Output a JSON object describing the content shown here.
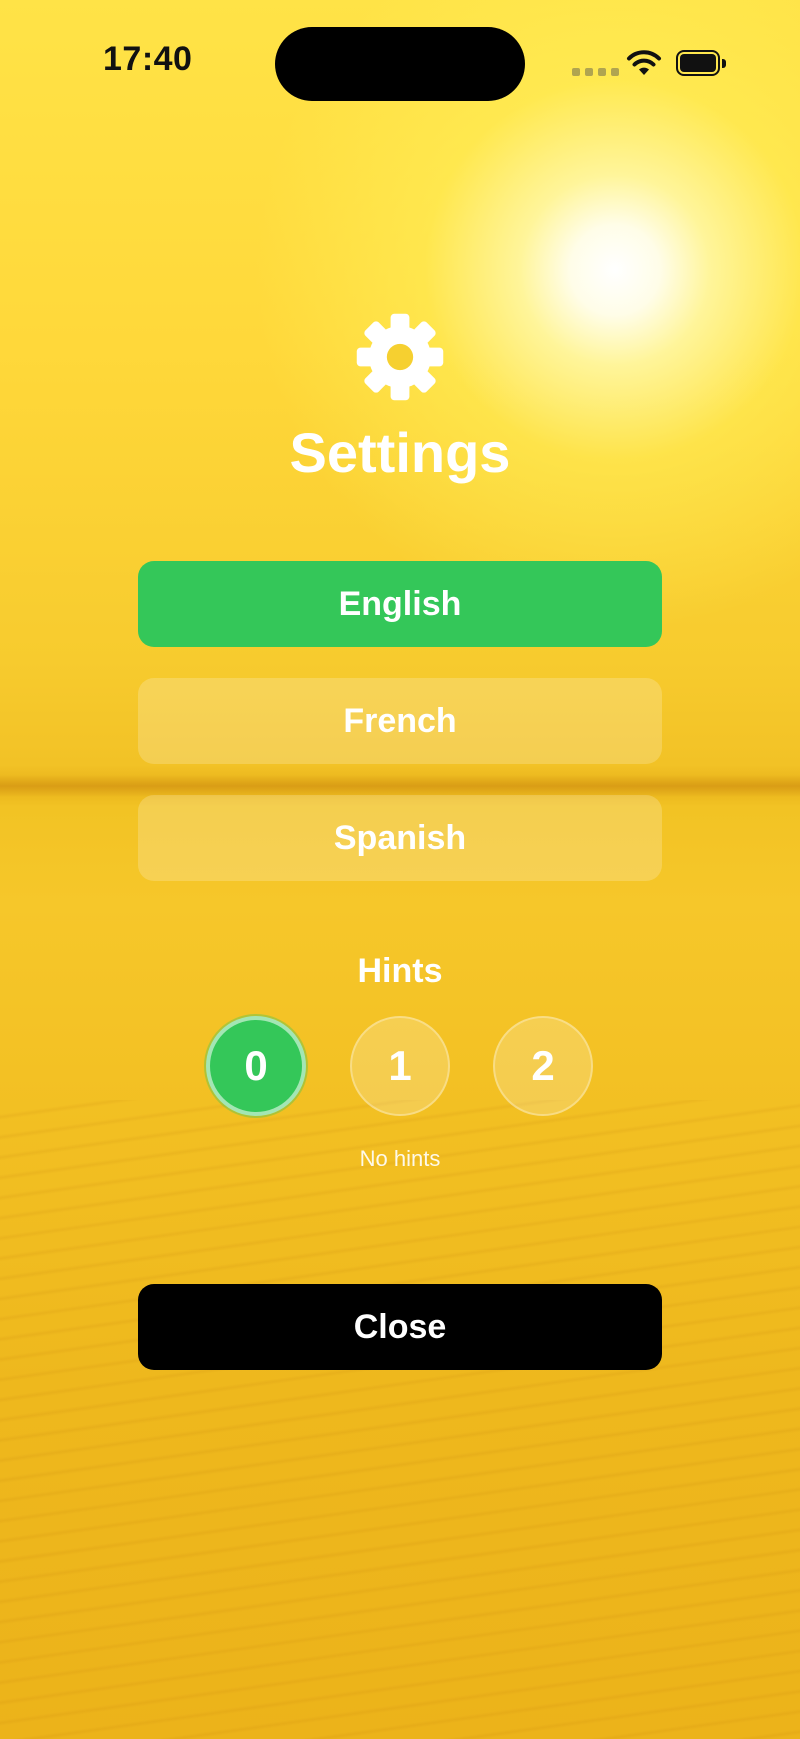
{
  "status_bar": {
    "time": "17:40",
    "icons": [
      "cellular-signal-icon",
      "wifi-icon",
      "battery-icon"
    ]
  },
  "header": {
    "icon": "gear-icon",
    "title": "Settings"
  },
  "languages": {
    "options": [
      {
        "label": "English",
        "selected": true
      },
      {
        "label": "French",
        "selected": false
      },
      {
        "label": "Spanish",
        "selected": false
      }
    ]
  },
  "hints": {
    "label": "Hints",
    "options": [
      {
        "label": "0",
        "selected": true
      },
      {
        "label": "1",
        "selected": false
      },
      {
        "label": "2",
        "selected": false
      }
    ],
    "description": "No hints"
  },
  "close_label": "Close",
  "colors": {
    "accent_green": "#34c759",
    "close_button": "#000000",
    "background": "#f2c226"
  }
}
